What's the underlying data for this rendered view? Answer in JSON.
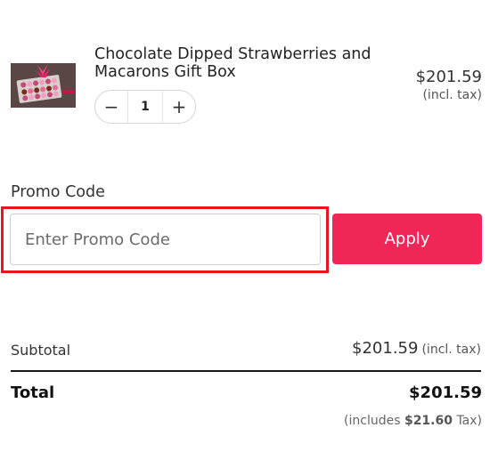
{
  "cart_item": {
    "name": "Chocolate Dipped Strawberries and Macarons Gift Box",
    "price": "$201.59",
    "price_tax_note": "(incl. tax)",
    "quantity": "1",
    "decrease_symbol": "−",
    "increase_symbol": "+"
  },
  "promo": {
    "label": "Promo Code",
    "placeholder": "Enter Promo Code",
    "value": "",
    "apply_label": "Apply"
  },
  "summary": {
    "subtotal_label": "Subtotal",
    "subtotal_value": "$201.59",
    "subtotal_tax_note": "(incl. tax)",
    "total_label": "Total",
    "total_value": "$201.59",
    "tax_note_prefix": "(includes",
    "tax_amount": "$21.60",
    "tax_note_suffix": "Tax)"
  },
  "colors": {
    "accent": "#f02656",
    "highlight": "#e8151d"
  },
  "icons": {
    "thumbnail": "gift-box-thumbnail"
  }
}
